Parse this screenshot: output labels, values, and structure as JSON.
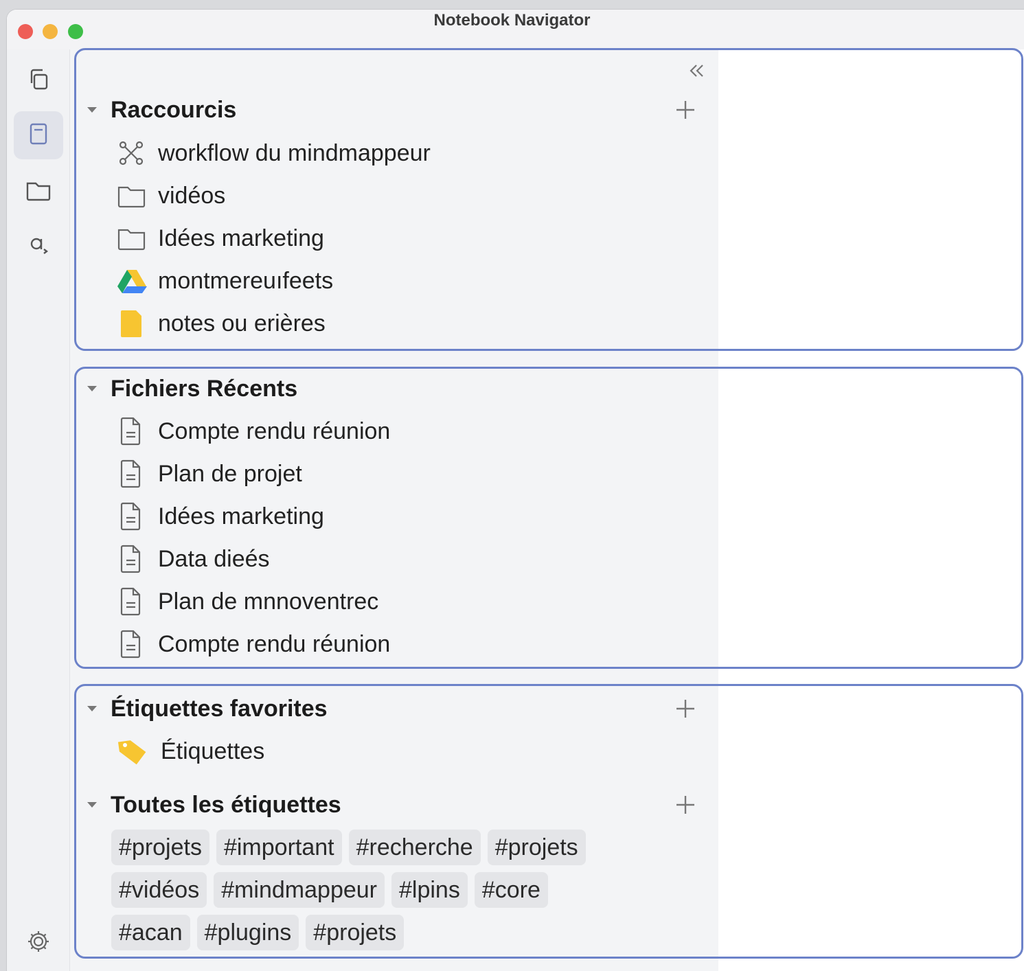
{
  "window": {
    "title": "Notebook Navigator"
  },
  "ribbon": {
    "items": [
      {
        "name": "copy-icon"
      },
      {
        "name": "notebook-icon",
        "active": true
      },
      {
        "name": "folder-icon"
      },
      {
        "name": "search-icon"
      }
    ],
    "settings_icon": "gear-icon"
  },
  "shortcuts": {
    "title": "Raccourcis",
    "items": [
      {
        "label": "workflow du mindmappeur",
        "icon": "mindmap-icon"
      },
      {
        "label": "vidéos",
        "icon": "folder-icon"
      },
      {
        "label": "Idées marketing",
        "icon": "folder-icon"
      },
      {
        "label": "montmereuıfeets",
        "icon": "drive-icon"
      },
      {
        "label": "notes ou erières",
        "icon": "yellow-folder-icon"
      }
    ]
  },
  "recent": {
    "title": "Fichiers Récents",
    "items": [
      {
        "label": "Compte rendu réunion",
        "icon": "document-icon"
      },
      {
        "label": "Plan de projet",
        "icon": "document-icon"
      },
      {
        "label": "Idées marketing",
        "icon": "document-icon"
      },
      {
        "label": "Data dieés",
        "icon": "document-icon"
      },
      {
        "label": "Plan de mnnoventrec",
        "icon": "document-icon"
      },
      {
        "label": "Compte rendu réunion",
        "icon": "document-icon"
      }
    ]
  },
  "favorite_tags": {
    "title": "Étiquettes favorites",
    "items": [
      {
        "label": "Étiquettes",
        "icon": "tag-icon"
      }
    ]
  },
  "all_tags": {
    "title": "Toutes les étiquettes",
    "rows": [
      [
        "#projets",
        "#important",
        "#recherche",
        "#projets"
      ],
      [
        "#vidéos",
        "#mindmappeur",
        "#lpins",
        "#core"
      ],
      [
        "#acan",
        "#plugins",
        "#projets"
      ]
    ]
  },
  "colors": {
    "frame": "#6c82c9",
    "pane": "#f3f4f6",
    "tag_bg": "#e4e5e8",
    "accent_yellow": "#f7c531"
  }
}
